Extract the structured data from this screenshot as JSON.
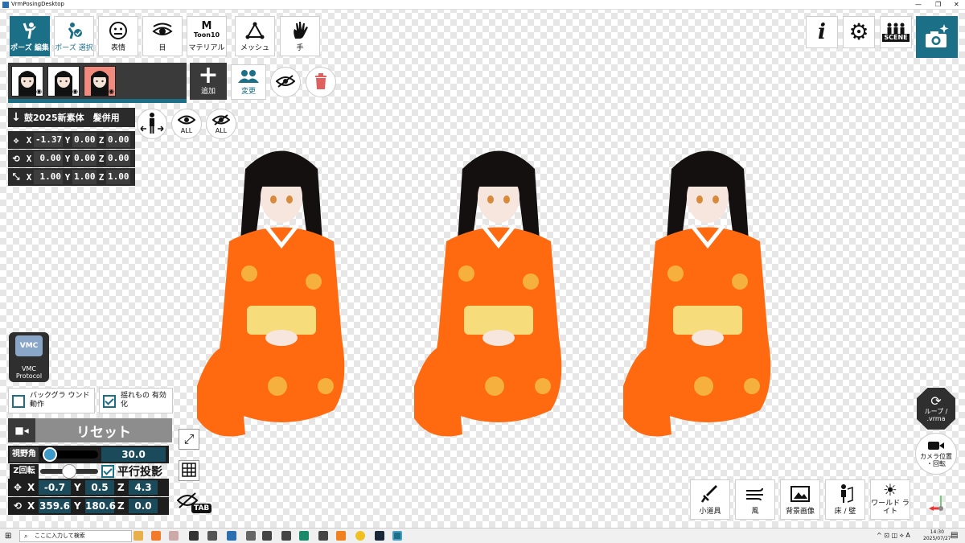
{
  "window": {
    "title": "VrmPosingDesktop"
  },
  "toolbar": [
    {
      "name": "pose-edit",
      "label": "ポーズ 編集",
      "active": true
    },
    {
      "name": "pose-select",
      "label": "ポーズ 選択"
    },
    {
      "name": "expression",
      "label": "表情"
    },
    {
      "name": "eye",
      "label": "目"
    },
    {
      "name": "material",
      "label": "マテリアル",
      "top": "Toon10"
    },
    {
      "name": "mesh",
      "label": "メッシュ"
    },
    {
      "name": "hand",
      "label": "手"
    }
  ],
  "top_right": {
    "scene_label": "SCENE"
  },
  "avatars": {
    "add_label": "追加",
    "change_label": "変更"
  },
  "transform": {
    "object_name": "鼓2025新素体　髪併用",
    "position": {
      "x": "-1.37",
      "y": "0.00",
      "z": "0.00"
    },
    "rotation": {
      "x": "0.00",
      "y": "0.00",
      "z": "0.00"
    },
    "scale": {
      "x": "1.00",
      "y": "1.00",
      "z": "1.00"
    },
    "show_all_label": "ALL",
    "hide_all_label": "ALL"
  },
  "vmc": {
    "label": "VMC Protocol"
  },
  "options": {
    "background_label": "バックグラ ウンド動作",
    "background_checked": false,
    "physics_label": "揺れもの 有効化",
    "physics_checked": true
  },
  "camera": {
    "reset_label": "リセット",
    "fov_label": "視野角",
    "fov_value": "30.0",
    "fov_level": 0.05,
    "zrot_label": "Z回転",
    "zrot_level": 0.5,
    "ortho_label": "平行投影",
    "ortho_checked": true,
    "pos": {
      "x": "-0.7",
      "y": "0.5",
      "z": "4.3"
    },
    "rot": {
      "x": "359.6",
      "y": "180.6",
      "z": "0.0"
    },
    "tab_label": "TAB"
  },
  "right_controls": {
    "loop_label": "ループ / .vrma",
    "camera_pos_label": "カメラ位置 ・回転"
  },
  "bottom_tools": [
    {
      "name": "prop",
      "label": "小道具"
    },
    {
      "name": "wind",
      "label": "風"
    },
    {
      "name": "background-image",
      "label": "背景画像"
    },
    {
      "name": "floor-wall",
      "label": "床 / 壁"
    },
    {
      "name": "world-light",
      "label": "ワールド ライト"
    }
  ],
  "taskbar": {
    "search_placeholder": "ここに入力して検索",
    "time": "14:30",
    "date": "2025/07/27"
  },
  "colors": {
    "accent": "#1b6f87",
    "kimono": "#ff6a10",
    "panel": "#2b2b2b"
  }
}
